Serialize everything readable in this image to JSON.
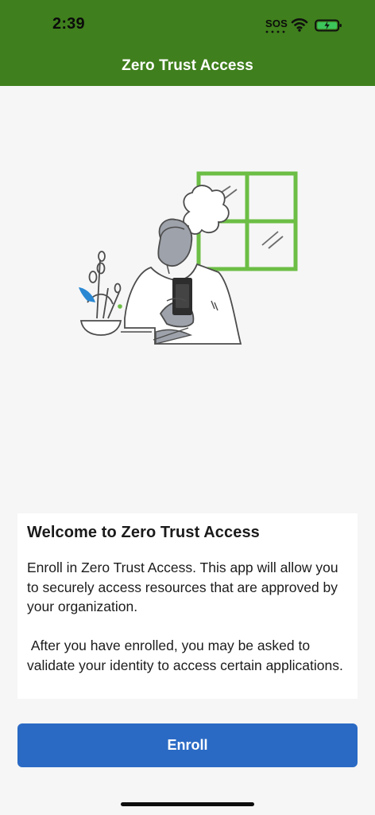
{
  "status_bar": {
    "time": "2:39",
    "sos_label": "SOS",
    "wifi_icon": "wifi-icon",
    "battery_icon": "battery-charging-icon"
  },
  "header": {
    "title": "Zero Trust Access",
    "background_color": "#3f7f1d"
  },
  "hero": {
    "illustration": "person-using-phone-illustration"
  },
  "welcome": {
    "title": "Welcome to Zero Trust Access",
    "body": "Enroll in Zero Trust Access. This app will allow you to securely access resources that are approved by your organization.\n\n After you have enrolled, you may be asked to validate your identity to access certain applications."
  },
  "actions": {
    "enroll_label": "Enroll",
    "button_color": "#2a6ac4"
  }
}
